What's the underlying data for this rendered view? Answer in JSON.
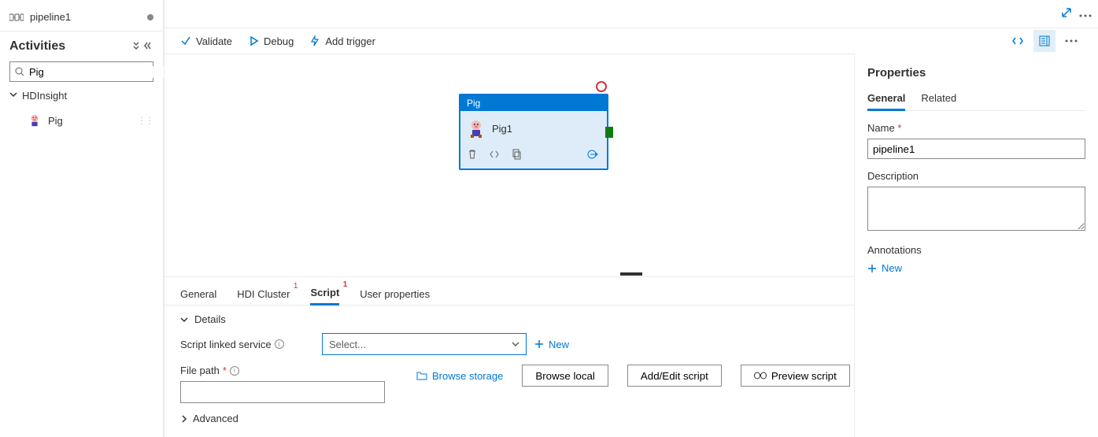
{
  "header": {
    "tab_title": "pipeline1"
  },
  "activities": {
    "title": "Activities",
    "search_value": "Pig",
    "category": "HDInsight",
    "item_label": "Pig"
  },
  "toolbar": {
    "validate": "Validate",
    "debug": "Debug",
    "add_trigger": "Add trigger"
  },
  "canvas": {
    "node_type": "Pig",
    "node_name": "Pig1"
  },
  "bottom": {
    "tabs": {
      "general": "General",
      "hdi_cluster": "HDI Cluster",
      "hdi_badge": "1",
      "script": "Script",
      "script_badge": "1",
      "user_properties": "User properties"
    },
    "details_label": "Details",
    "script_linked_service": "Script linked service",
    "select_placeholder": "Select...",
    "new_link": "New",
    "file_path": "File path",
    "file_path_value": "",
    "browse_storage": "Browse storage",
    "browse_local": "Browse local",
    "add_edit_script": "Add/Edit script",
    "preview_script": "Preview script",
    "advanced": "Advanced"
  },
  "props": {
    "title": "Properties",
    "tabs": {
      "general": "General",
      "related": "Related"
    },
    "name_label": "Name",
    "name_value": "pipeline1",
    "description_label": "Description",
    "description_value": "",
    "annotations_label": "Annotations",
    "new": "New"
  }
}
